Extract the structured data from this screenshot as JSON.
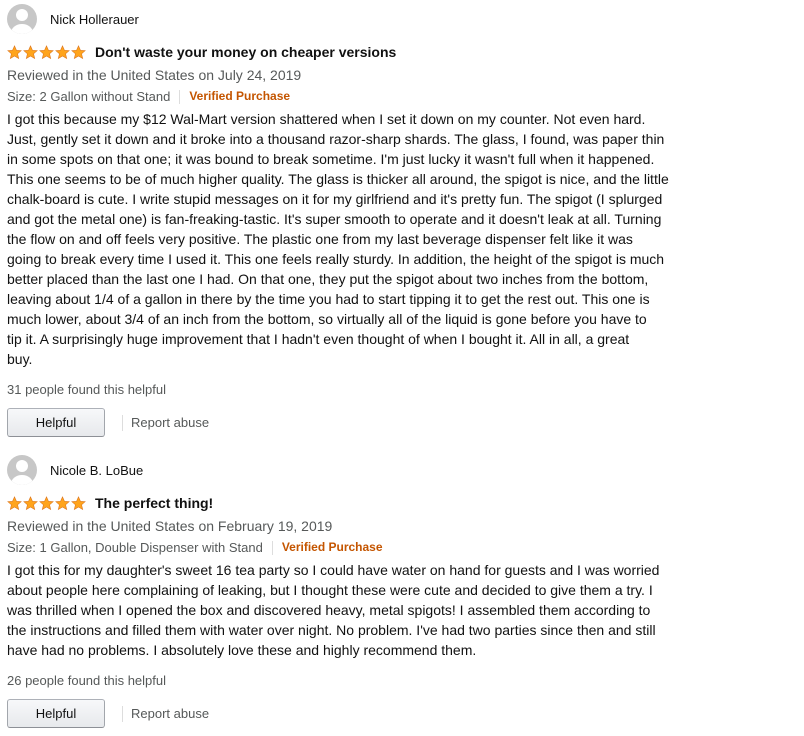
{
  "colors": {
    "star": "#ffa41c",
    "verified": "#c45500",
    "secondary_text": "#565959"
  },
  "reviews": [
    {
      "author": "Nick Hollerauer",
      "rating": 5,
      "title": "Don't waste your money on cheaper versions",
      "date": "Reviewed in the United States on July 24, 2019",
      "format": "Size: 2 Gallon without Stand",
      "verified": "Verified Purchase",
      "body": "I got this because my $12 Wal-Mart version shattered when I set it down on my counter. Not even hard.\nJust, gently set it down and it broke into a thousand razor-sharp shards. The glass, I found, was paper thin\nin some spots on that one; it was bound to break sometime. I'm just lucky it wasn't full when it happened.\nThis one seems to be of much higher quality. The glass is thicker all around, the spigot is nice, and the little\nchalk-board is cute. I write stupid messages on it for my girlfriend and it's pretty fun. The spigot (I splurged\nand got the metal one) is fan-freaking-tastic. It's super smooth to operate and it doesn't leak at all. Turning\nthe flow on and off feels very positive. The plastic one from my last beverage dispenser felt like it was\ngoing to break every time I used it. This one feels really sturdy. In addition, the height of the spigot is much\nbetter placed than the last one I had. On that one, they put the spigot about two inches from the bottom,\nleaving about 1/4 of a gallon in there by the time you had to start tipping it to get the rest out. This one is\nmuch lower, about 3/4 of an inch from the bottom, so virtually all of the liquid is gone before you have to\ntip it. A surprisingly huge improvement that I hadn't even thought of when I bought it. All in all, a great\nbuy.",
      "helpful_count_text": "31 people found this helpful",
      "helpful_button": "Helpful",
      "report": "Report abuse"
    },
    {
      "author": "Nicole B. LoBue",
      "rating": 5,
      "title": "The perfect thing!",
      "date": "Reviewed in the United States on February 19, 2019",
      "format": "Size: 1 Gallon, Double Dispenser with Stand",
      "verified": "Verified Purchase",
      "body": "I got this for my daughter's sweet 16 tea party so I could have water on hand for guests and I was worried\nabout people here complaining of leaking, but I thought these were cute and decided to give them a try. I\nwas thrilled when I opened the box and discovered heavy, metal spigots! I assembled them according to\nthe instructions and filled them with water over night. No problem. I've had two parties since then and still\nhave had no problems. I absolutely love these and highly recommend them.",
      "helpful_count_text": "26 people found this helpful",
      "helpful_button": "Helpful",
      "report": "Report abuse"
    }
  ]
}
